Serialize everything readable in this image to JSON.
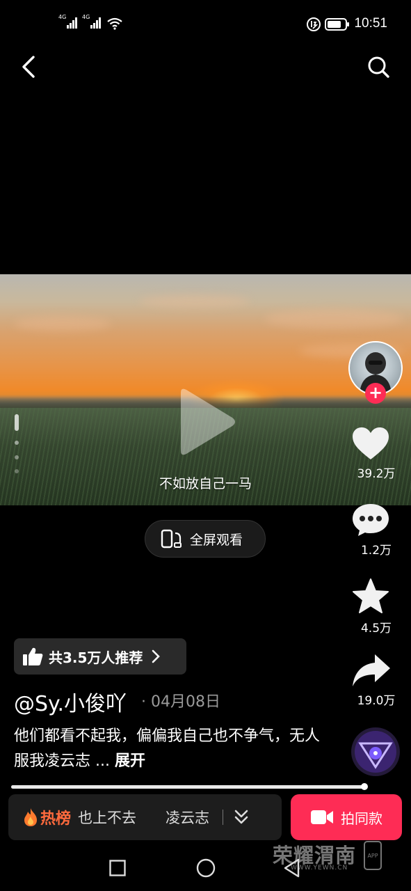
{
  "status_bar": {
    "network_1": "4G",
    "network_2": "4G",
    "time": "10:51",
    "icons": [
      "signal-icon",
      "signal-icon",
      "wifi-icon",
      "data-saver-icon",
      "battery-icon"
    ]
  },
  "nav": {
    "back_icon": "chevron-left-icon",
    "search_icon": "search-icon"
  },
  "video": {
    "subtitle": "不如放自己一马",
    "play_icon": "play-icon"
  },
  "fullscreen": {
    "label": "全屏观看",
    "icon": "rotate-screen-icon"
  },
  "actions": {
    "like_count": "39.2万",
    "comment_count": "1.2万",
    "favorite_count": "4.5万",
    "share_count": "19.0万",
    "follow_symbol": "+"
  },
  "recommend": {
    "label": "共3.5万人推荐",
    "icon": "thumbs-up-icon"
  },
  "post": {
    "author": "@Sy.小俊吖",
    "date": "· 04月08日",
    "caption": "他们都看不起我，偏偏我自己也不争气，无人服我凌云志 ...",
    "expand_label": "展开",
    "progress": 0.99
  },
  "hot_bar": {
    "label": "热榜",
    "item_1": "也上不去",
    "item_2": "凌云志",
    "icons": [
      "flame-icon",
      "double-chevron-down-icon"
    ]
  },
  "shoot_button": {
    "label": "拍同款",
    "icon": "video-camera-icon"
  },
  "watermark": {
    "title": "荣耀渭南",
    "url": "WWW.YEWN.CN",
    "app": "APP"
  },
  "colors": {
    "accent": "#fe2c55",
    "hot": "#ff6a3d",
    "background": "#000000"
  }
}
